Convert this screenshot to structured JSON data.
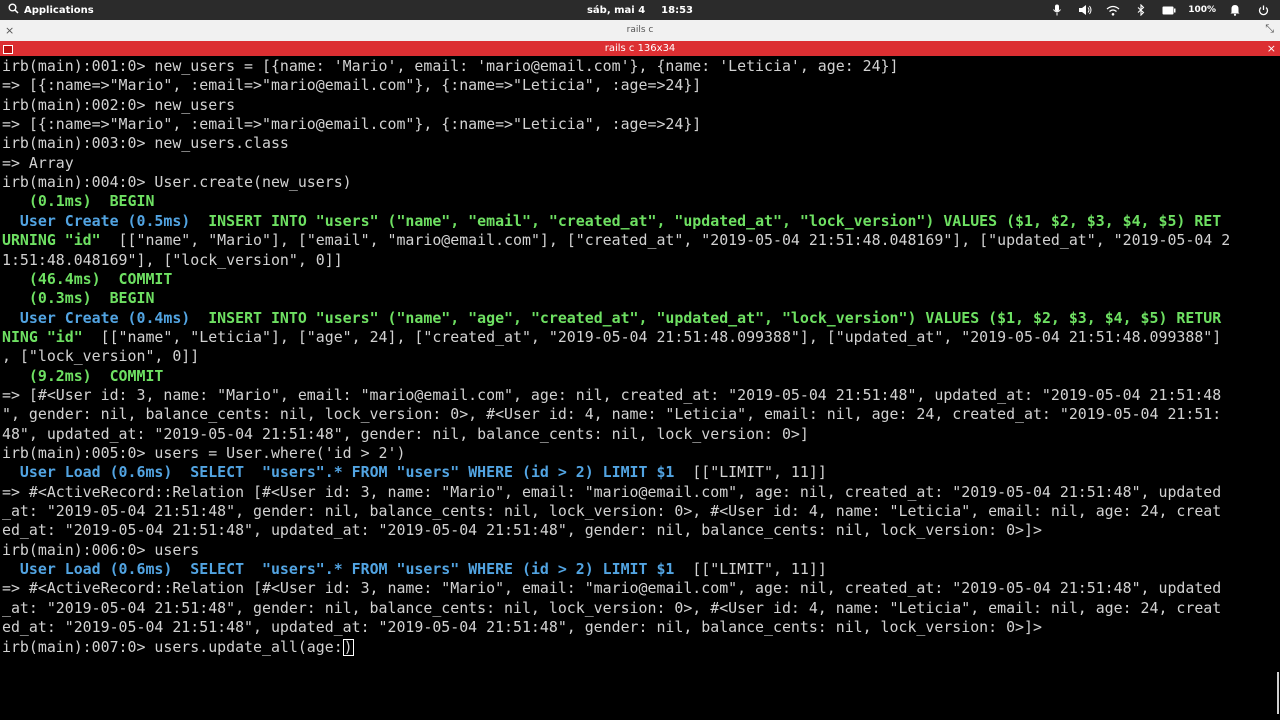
{
  "topbar": {
    "applications_label": "Applications",
    "date": "sáb, mai 4",
    "time": "18:53",
    "battery_percent": "100%",
    "icons": [
      "search-icon",
      "microphone-icon",
      "volume-icon",
      "wifi-icon",
      "bluetooth-icon",
      "battery-icon",
      "notification-icon",
      "power-icon"
    ]
  },
  "window": {
    "title": "rails c",
    "close_glyph": "×",
    "expand_glyph": "⤡"
  },
  "tab": {
    "title": "rails c 136x34",
    "close_glyph": "×"
  },
  "colors": {
    "background": "#000000",
    "text": "#d2d2d2",
    "sql_timing": "#6ee062",
    "sql_keyword": "#52a4e2",
    "tab_red": "#dc2f32"
  },
  "terminal": {
    "lines": [
      [
        {
          "t": "irb(main):001:0> new_users = [{name: 'Mario', email: 'mario@email.com'}, {name: 'Leticia', age: 24}]",
          "c": ""
        }
      ],
      [
        {
          "t": "=> [{:name=>\"Mario\", :email=>\"mario@email.com\"}, {:name=>\"Leticia\", :age=>24}]",
          "c": ""
        }
      ],
      [
        {
          "t": "irb(main):002:0> new_users",
          "c": ""
        }
      ],
      [
        {
          "t": "=> [{:name=>\"Mario\", :email=>\"mario@email.com\"}, {:name=>\"Leticia\", :age=>24}]",
          "c": ""
        }
      ],
      [
        {
          "t": "irb(main):003:0> new_users.class",
          "c": ""
        }
      ],
      [
        {
          "t": "=> Array",
          "c": ""
        }
      ],
      [
        {
          "t": "irb(main):004:0> User.create(new_users)",
          "c": ""
        }
      ],
      [
        {
          "t": "   (0.1ms)  BEGIN",
          "c": "g"
        }
      ],
      [
        {
          "t": "  User Create (0.5ms)  ",
          "c": "b"
        },
        {
          "t": "INSERT INTO \"users\" (\"name\", \"email\", \"created_at\", \"updated_at\", \"lock_version\") VALUES ($1, $2, $3, $4, $5) RET",
          "c": "g"
        }
      ],
      [
        {
          "t": "URNING \"id\"",
          "c": "g"
        },
        {
          "t": "  [[\"name\", \"Mario\"], [\"email\", \"mario@email.com\"], [\"created_at\", \"2019-05-04 21:51:48.048169\"], [\"updated_at\", \"2019-05-04 2",
          "c": ""
        }
      ],
      [
        {
          "t": "1:51:48.048169\"], [\"lock_version\", 0]]",
          "c": ""
        }
      ],
      [
        {
          "t": "   (46.4ms)  COMMIT",
          "c": "g"
        }
      ],
      [
        {
          "t": "   (0.3ms)  BEGIN",
          "c": "g"
        }
      ],
      [
        {
          "t": "  User Create (0.4ms)  ",
          "c": "b"
        },
        {
          "t": "INSERT INTO \"users\" (\"name\", \"age\", \"created_at\", \"updated_at\", \"lock_version\") VALUES ($1, $2, $3, $4, $5) RETUR",
          "c": "g"
        }
      ],
      [
        {
          "t": "NING \"id\"",
          "c": "g"
        },
        {
          "t": "  [[\"name\", \"Leticia\"], [\"age\", 24], [\"created_at\", \"2019-05-04 21:51:48.099388\"], [\"updated_at\", \"2019-05-04 21:51:48.099388\"]",
          "c": ""
        }
      ],
      [
        {
          "t": ", [\"lock_version\", 0]]",
          "c": ""
        }
      ],
      [
        {
          "t": "   (9.2ms)  COMMIT",
          "c": "g"
        }
      ],
      [
        {
          "t": "=> [#<User id: 3, name: \"Mario\", email: \"mario@email.com\", age: nil, created_at: \"2019-05-04 21:51:48\", updated_at: \"2019-05-04 21:51:48",
          "c": ""
        }
      ],
      [
        {
          "t": "\", gender: nil, balance_cents: nil, lock_version: 0>, #<User id: 4, name: \"Leticia\", email: nil, age: 24, created_at: \"2019-05-04 21:51:",
          "c": ""
        }
      ],
      [
        {
          "t": "48\", updated_at: \"2019-05-04 21:51:48\", gender: nil, balance_cents: nil, lock_version: 0>]",
          "c": ""
        }
      ],
      [
        {
          "t": "irb(main):005:0> users = User.where('id > 2')",
          "c": ""
        }
      ],
      [
        {
          "t": "  User Load (0.6ms)  ",
          "c": "b"
        },
        {
          "t": "SELECT  ",
          "c": "b"
        },
        {
          "t": "\"users\".* FROM \"users\" WHERE (id > 2) LIMIT $1",
          "c": "b"
        },
        {
          "t": "  [[\"LIMIT\", 11]]",
          "c": ""
        }
      ],
      [
        {
          "t": "=> #<ActiveRecord::Relation [#<User id: 3, name: \"Mario\", email: \"mario@email.com\", age: nil, created_at: \"2019-05-04 21:51:48\", updated",
          "c": ""
        }
      ],
      [
        {
          "t": "_at: \"2019-05-04 21:51:48\", gender: nil, balance_cents: nil, lock_version: 0>, #<User id: 4, name: \"Leticia\", email: nil, age: 24, creat",
          "c": ""
        }
      ],
      [
        {
          "t": "ed_at: \"2019-05-04 21:51:48\", updated_at: \"2019-05-04 21:51:48\", gender: nil, balance_cents: nil, lock_version: 0>]>",
          "c": ""
        }
      ],
      [
        {
          "t": "irb(main):006:0> users",
          "c": ""
        }
      ],
      [
        {
          "t": "  User Load (0.6ms)  ",
          "c": "b"
        },
        {
          "t": "SELECT  ",
          "c": "b"
        },
        {
          "t": "\"users\".* FROM \"users\" WHERE (id > 2) LIMIT $1",
          "c": "b"
        },
        {
          "t": "  [[\"LIMIT\", 11]]",
          "c": ""
        }
      ],
      [
        {
          "t": "=> #<ActiveRecord::Relation [#<User id: 3, name: \"Mario\", email: \"mario@email.com\", age: nil, created_at: \"2019-05-04 21:51:48\", updated",
          "c": ""
        }
      ],
      [
        {
          "t": "_at: \"2019-05-04 21:51:48\", gender: nil, balance_cents: nil, lock_version: 0>, #<User id: 4, name: \"Leticia\", email: nil, age: 24, creat",
          "c": ""
        }
      ],
      [
        {
          "t": "ed_at: \"2019-05-04 21:51:48\", updated_at: \"2019-05-04 21:51:48\", gender: nil, balance_cents: nil, lock_version: 0>]>",
          "c": ""
        }
      ],
      [
        {
          "t": "irb(main):007:0> users.update_all(age:",
          "c": ""
        },
        {
          "t": ")",
          "c": "cur"
        }
      ]
    ]
  }
}
